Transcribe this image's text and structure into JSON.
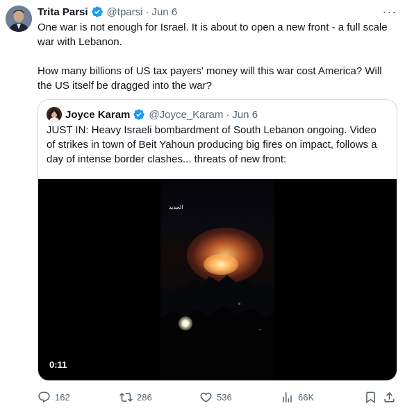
{
  "tweet": {
    "author_name": "Trita Parsi",
    "handle": "@tparsi",
    "date": "Jun 6",
    "separator": "·",
    "more_label": "···",
    "text_p1": "One war is not enough for Israel. It is about to open a new front - a full scale war with Lebanon.",
    "text_p2": "How many billions of US tax payers' money will this war cost America? Will the US itself be dragged into the war?"
  },
  "quote": {
    "author_name": "Joyce Karam",
    "handle": "@Joyce_Karam",
    "date": "Jun 6",
    "separator": "·",
    "text": "JUST IN: Heavy Israeli bombardment of South Lebanon ongoing. Video of strikes in town of Beit Yahoun producing big fires on impact, follows a day of intense border clashes... threats of new front:",
    "video": {
      "duration": "0:11",
      "channel_logo": "الجديد"
    }
  },
  "actions": {
    "replies": "162",
    "retweets": "286",
    "likes": "536",
    "views": "66K"
  },
  "colors": {
    "verified": "#1d9bf0",
    "text": "#0f1419",
    "secondary": "#536471",
    "border": "#cfd9de"
  }
}
